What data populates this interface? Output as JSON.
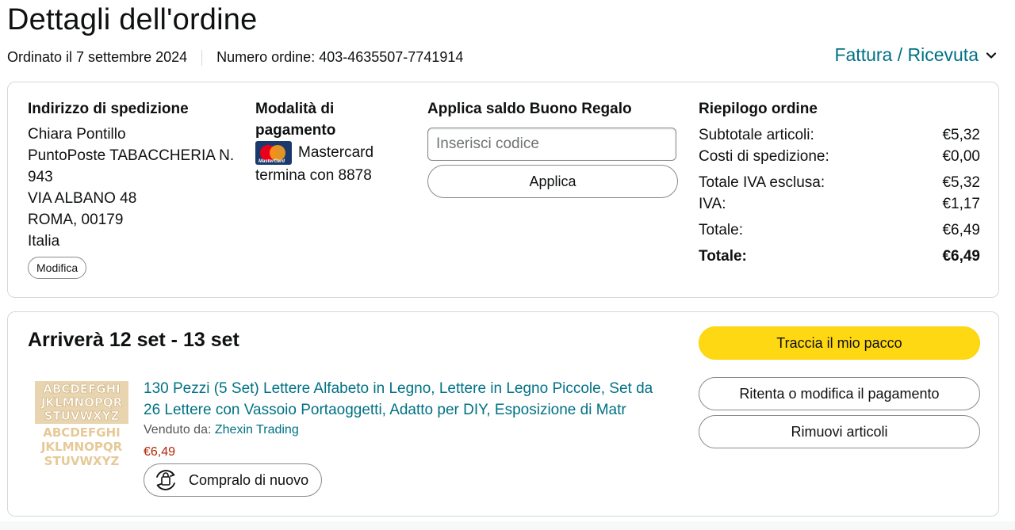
{
  "header": {
    "title": "Dettagli dell'ordine",
    "order_date": "Ordinato il 7 settembre 2024",
    "order_number": "Numero ordine: 403-4635507-7741914",
    "invoice_link": "Fattura / Ricevuta"
  },
  "shipping": {
    "heading": "Indirizzo di spedizione",
    "lines": [
      "Chiara Pontillo",
      "PuntoPoste TABACCHERIA N. 943",
      "VIA ALBANO 48",
      "ROMA, 00179",
      "Italia"
    ],
    "edit_label": "Modifica"
  },
  "payment": {
    "heading": "Modalità di pagamento",
    "card_name": "Mastercard",
    "card_ending": "termina con 8878",
    "card_logo_text": "MasterCard",
    "icon": "mastercard-logo"
  },
  "gift": {
    "heading": "Applica saldo Buono Regalo",
    "placeholder": "Inserisci codice",
    "value": "",
    "apply_label": "Applica"
  },
  "summary": {
    "heading": "Riepilogo ordine",
    "rows": [
      {
        "label": "Subtotale articoli:",
        "value": "€5,32"
      },
      {
        "label": "Costi di spedizione:",
        "value": "€0,00"
      },
      {
        "label": "Totale IVA esclusa:",
        "value": "€5,32"
      },
      {
        "label": "IVA:",
        "value": "€1,17"
      },
      {
        "label": "Totale:",
        "value": "€6,49"
      },
      {
        "label": "Totale:",
        "value": "€6,49"
      }
    ]
  },
  "shipment": {
    "arrival": "Arriverà 12 set - 13 set",
    "track_label": "Traccia il mio pacco",
    "retry_label": "Ritenta o modifica il pagamento",
    "remove_label": "Rimuovi articoli",
    "product": {
      "title": "130 Pezzi (5 Set) Lettere Alfabeto in Legno, Lettere in Legno Piccole, Set da 26 Lettere con Vassoio Portaoggetti, Adatto per DIY, Esposizione di Matr",
      "seller_prefix": "Venduto da:",
      "seller_name": "Zhexin Trading",
      "price": "€6,49",
      "rebuy_label": "Compralo di nuovo",
      "thumb_lines": [
        "ABCDEFGHI",
        "JKLMNOPQR",
        "STUVWXYZ",
        "ABCDEFGHI",
        "JKLMNOPQR",
        "STUVWXYZ"
      ]
    }
  },
  "colors": {
    "link": "#007185",
    "price": "#B12704",
    "primary_button": "#FFD814",
    "border": "#D5D9D9"
  }
}
